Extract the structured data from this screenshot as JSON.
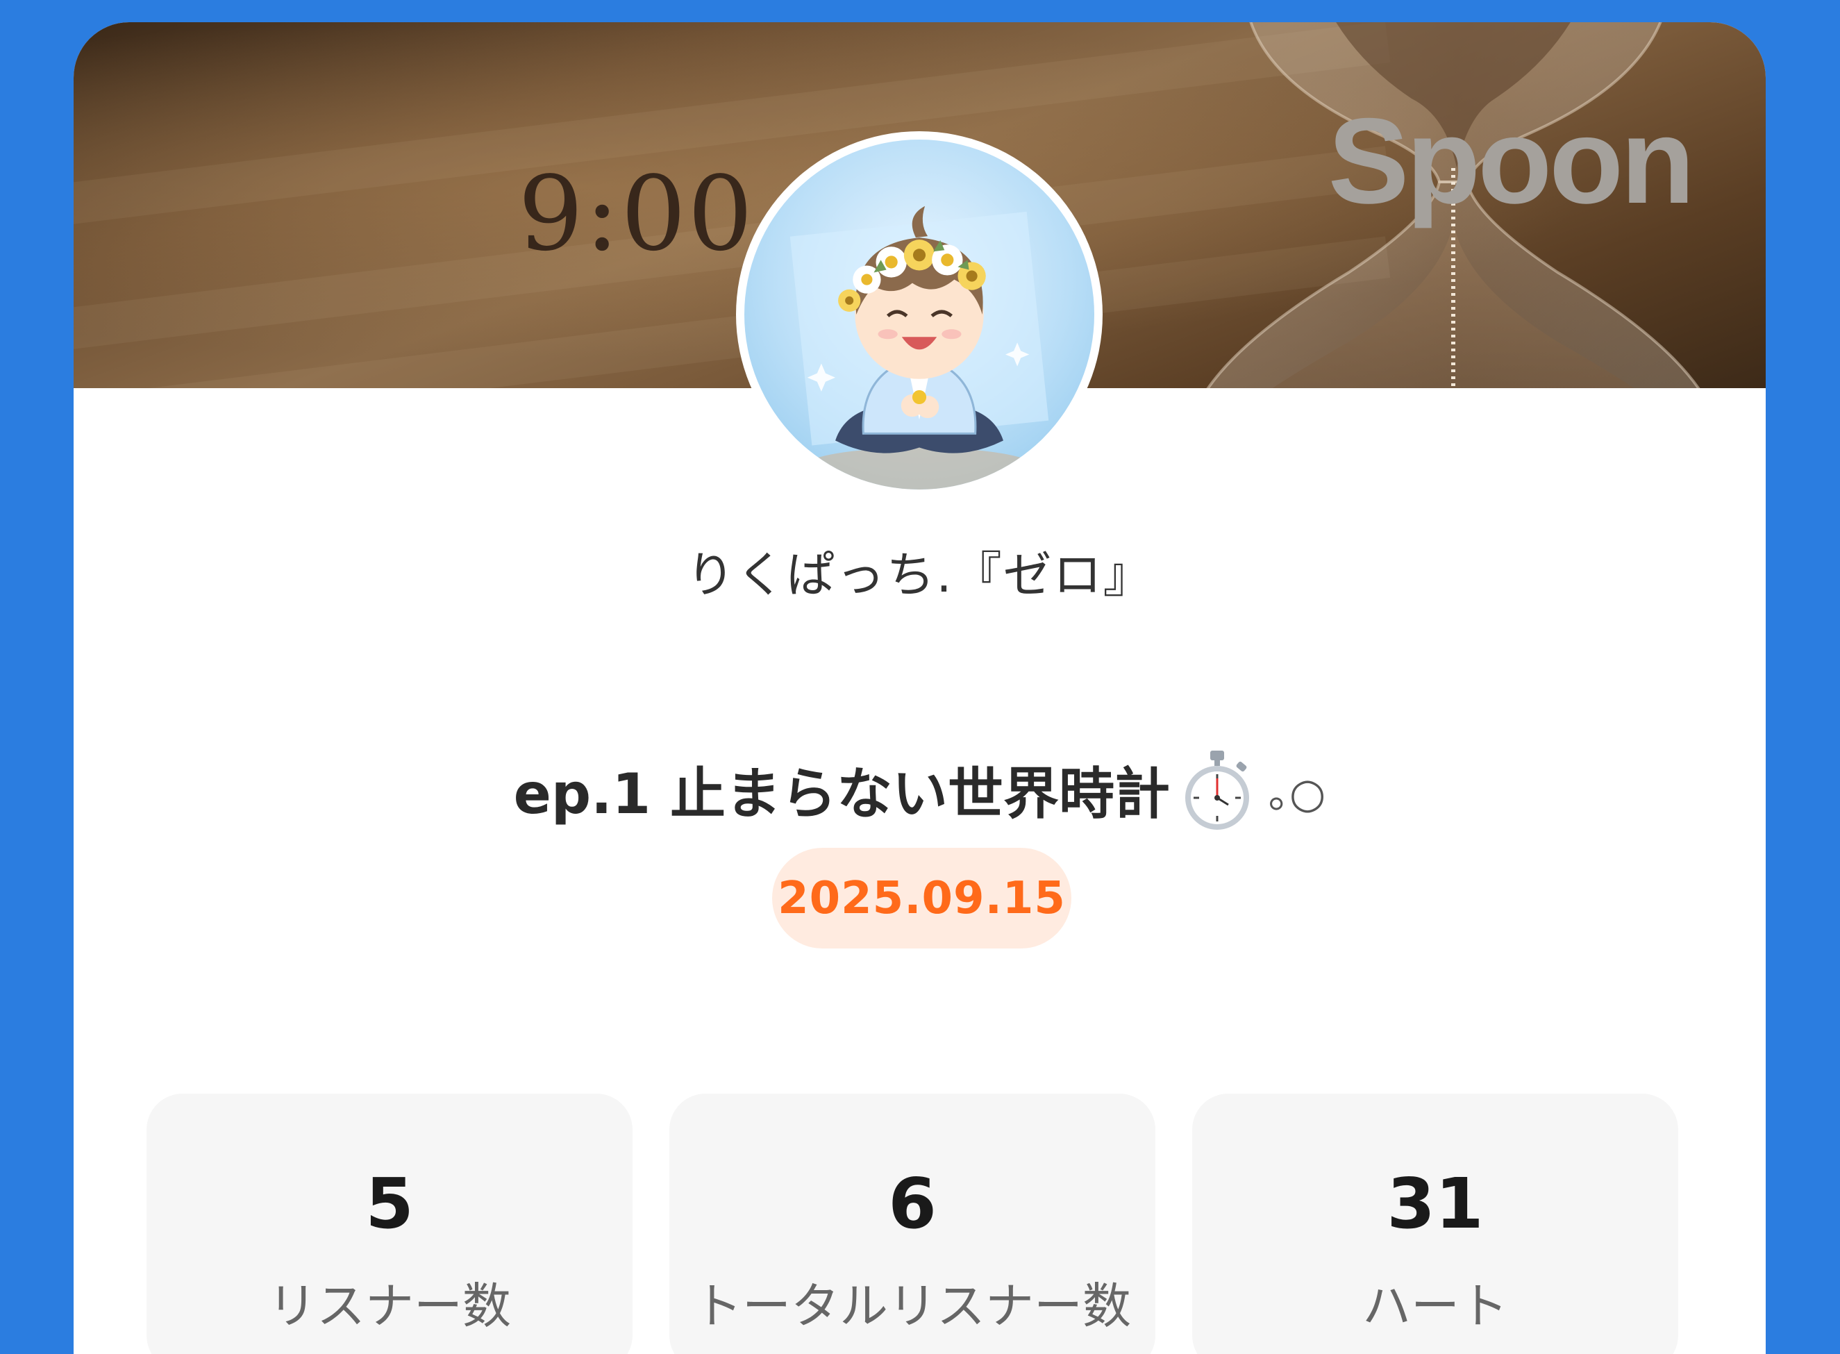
{
  "banner": {
    "time_text": "9:00",
    "logo_text": "Spoon"
  },
  "profile": {
    "username": "りくぱっち.『ゼロ』"
  },
  "episode": {
    "title": "ep.1 止まらない世界時計",
    "title_suffix": "｡○",
    "date": "2025.09.15"
  },
  "stats": [
    {
      "value": "5",
      "label": "リスナー数"
    },
    {
      "value": "6",
      "label": "トータルリスナー数"
    },
    {
      "value": "31",
      "label": "ハート"
    }
  ],
  "colors": {
    "background": "#2b7de0",
    "card": "#ffffff",
    "date_text": "#ff6a1a",
    "date_pill": "#ffebe0",
    "stat_box": "#f6f6f6"
  }
}
